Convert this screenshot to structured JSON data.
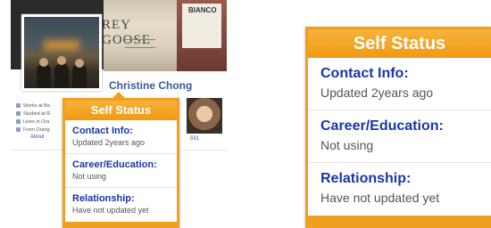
{
  "profile": {
    "name": "Christine Chong",
    "cover_text": "REY GOOSE",
    "cover_label": "BIANCO",
    "info_rows": [
      "Works at Ba",
      "Studied at R",
      "Lives in Ora",
      "From Orang"
    ],
    "about_link": "About",
    "thumb_count": "591"
  },
  "popup": {
    "title": "Self Status",
    "items": [
      {
        "title": "Contact Info:",
        "value": "Updated 2years ago"
      },
      {
        "title": "Career/Education:",
        "value": "Not using"
      },
      {
        "title": "Relationship:",
        "value": "Have not updated yet"
      }
    ]
  },
  "colors": {
    "accent": "#f0a020",
    "link": "#1a36a8",
    "brand": "#3b5998"
  }
}
